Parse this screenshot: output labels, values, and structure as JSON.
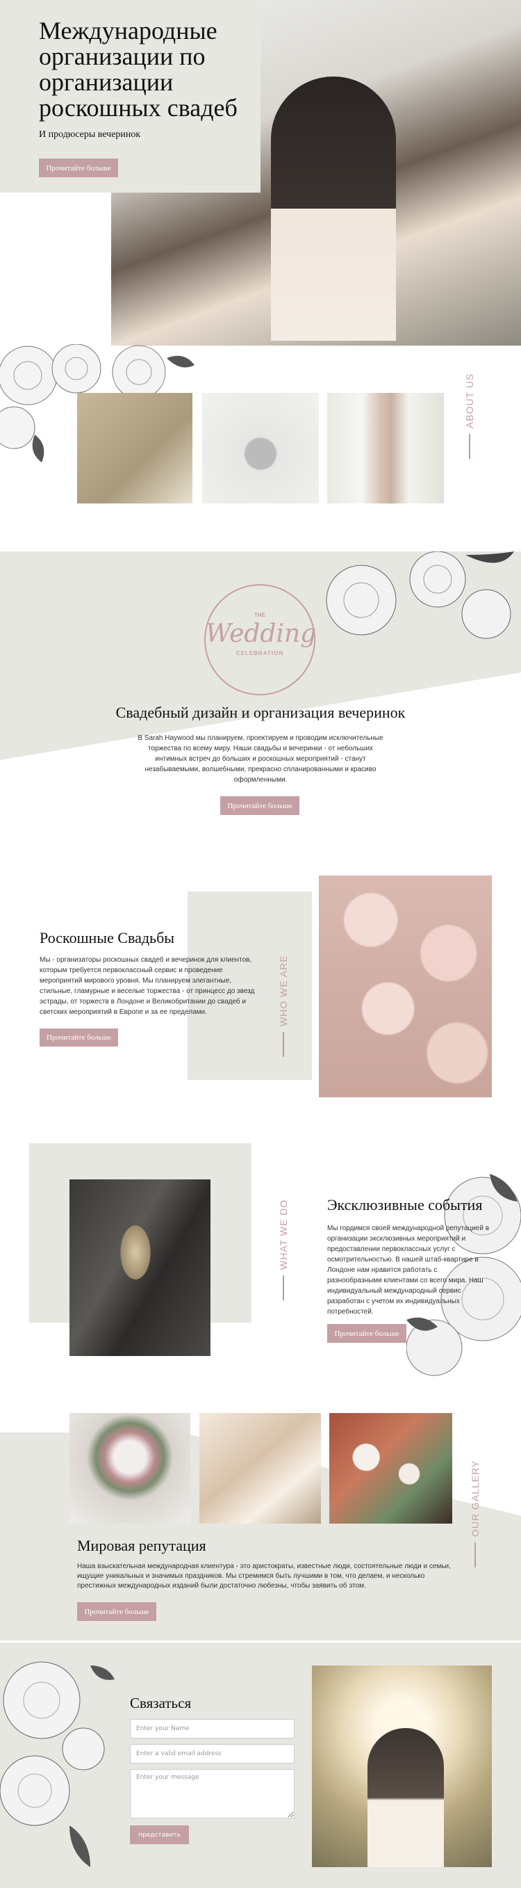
{
  "colors": {
    "accent": "#c4a0a4",
    "panel": "#e7e7e2",
    "text": "#111111"
  },
  "hero": {
    "title": "Международные организации по организации роскошных свадеб",
    "subtitle": "И продюсеры вечеринок",
    "button": "Прочитайте больше"
  },
  "about": {
    "label": "ABOUT US",
    "images": [
      "shoes-photo",
      "rings-photo",
      "dress-photo"
    ]
  },
  "design": {
    "logo": {
      "top": "THE",
      "script": "Wedding",
      "bottom": "CELEBRATION"
    },
    "title": "Свадебный дизайн и организация вечеринок",
    "text": "В Sarah Haywood мы планируем, проектируем и проводим исключительные торжества по всему миру. Наши свадьбы и вечеринки - от небольших интимных встреч до больших и роскошных мероприятий - станут незабываемыми, волшебными, прекрасно спланированными и красиво оформленными.",
    "button": "Прочитайте больше"
  },
  "who": {
    "label": "WHO WE ARE",
    "title": "Роскошные Свадьбы",
    "text": "Мы - организаторы роскошных свадеб и вечеринок для клиентов, которым требуется первоклассный сервис и проведение мероприятий мирового уровня. Мы планируем элегантные, стильные, гламурные и веселые торжества - от принцесс до звезд эстрады, от торжеств в Лондоне и Великобритании до свадеб и светских мероприятий в Европе и за ее пределами.",
    "button": "Прочитайте больше"
  },
  "what": {
    "label": "WHAT WE DO",
    "title": "Эксклюзивные события",
    "text": "Мы гордимся своей международной репутацией в организации эксклюзивных мероприятий и предоставлении первоклассных услуг с осмотрительностью. В нашей штаб-квартире в Лондоне нам нравится работать с разнообразными клиентами со всего мира. Наш индивидуальный международный сервис разработан с учетом их индивидуальных потребностей.",
    "button": "Прочитайте больше"
  },
  "gallery": {
    "label": "OUR GALLERY",
    "title": "Мировая репутация",
    "text": "Наша взыскательная международная клиентура - это аристократы, известные люди, состоятельные люди и семьи, ищущие уникальных и значимых праздников. Мы стремимся быть лучшими в том, что делаем, и несколько престижных международных изданий были достаточно любезны, чтобы заявить об этом.",
    "button": "Прочитайте больше"
  },
  "contact": {
    "title": "Связаться",
    "name_placeholder": "Enter your Name",
    "email_placeholder": "Enter a valid email address",
    "message_placeholder": "Enter your message",
    "submit": "представить"
  }
}
